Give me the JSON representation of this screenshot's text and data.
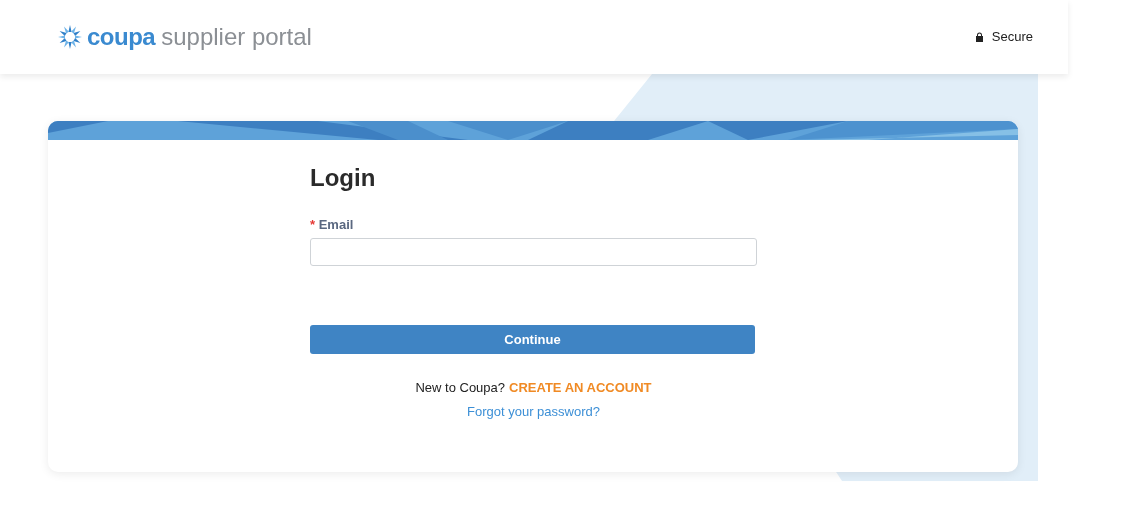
{
  "header": {
    "logo": {
      "brand": "coupa",
      "product": "supplier portal"
    },
    "secure_label": "Secure"
  },
  "login": {
    "title": "Login",
    "email_required_mark": "*",
    "email_label": "Email",
    "continue_button": "Continue",
    "new_prompt": "New to Coupa?",
    "create_account_link": "CREATE AN ACCOUNT",
    "forgot_link": "Forgot your password?"
  }
}
